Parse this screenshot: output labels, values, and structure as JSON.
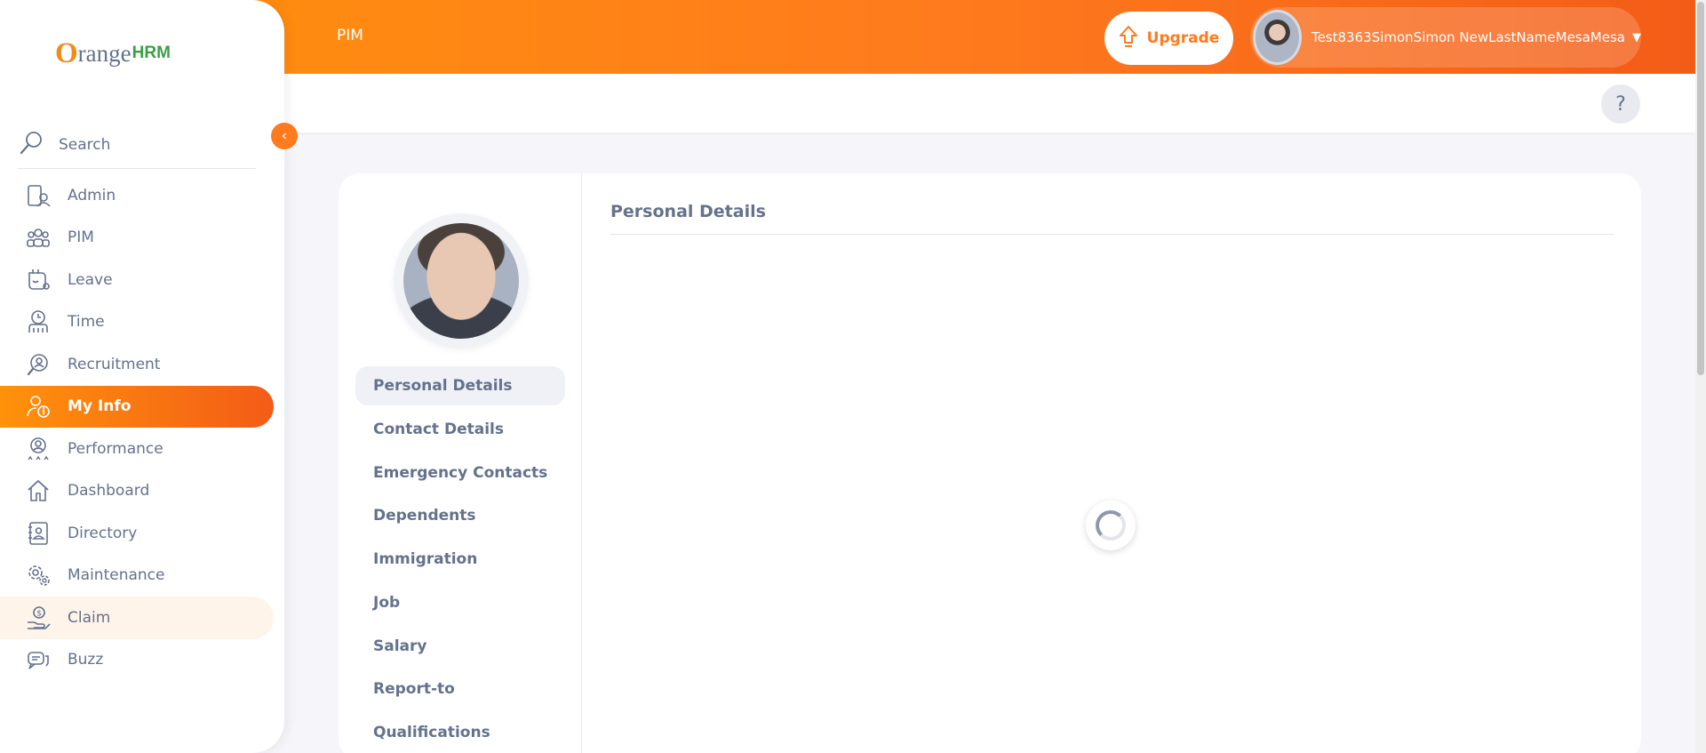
{
  "topbar": {
    "title": "PIM",
    "upgrade_label": "Upgrade",
    "user_name": "Test8363SimonSimon NewLastNameMesaMesa"
  },
  "sidebar": {
    "brand_main": "range",
    "brand_o": "O",
    "brand_suffix": "HRM",
    "search_label": "Search",
    "items": [
      {
        "label": "Admin",
        "icon": "admin-icon"
      },
      {
        "label": "PIM",
        "icon": "pim-icon"
      },
      {
        "label": "Leave",
        "icon": "leave-icon"
      },
      {
        "label": "Time",
        "icon": "time-icon"
      },
      {
        "label": "Recruitment",
        "icon": "recruitment-icon"
      },
      {
        "label": "My Info",
        "icon": "my-info-icon"
      },
      {
        "label": "Performance",
        "icon": "performance-icon"
      },
      {
        "label": "Dashboard",
        "icon": "dashboard-icon"
      },
      {
        "label": "Directory",
        "icon": "directory-icon"
      },
      {
        "label": "Maintenance",
        "icon": "maintenance-icon"
      },
      {
        "label": "Claim",
        "icon": "claim-icon"
      },
      {
        "label": "Buzz",
        "icon": "buzz-icon"
      }
    ]
  },
  "help": {
    "label": "?"
  },
  "profile": {
    "tabs": [
      {
        "label": "Personal Details"
      },
      {
        "label": "Contact Details"
      },
      {
        "label": "Emergency Contacts"
      },
      {
        "label": "Dependents"
      },
      {
        "label": "Immigration"
      },
      {
        "label": "Job"
      },
      {
        "label": "Salary"
      },
      {
        "label": "Report-to"
      },
      {
        "label": "Qualifications"
      }
    ],
    "content_title": "Personal Details"
  },
  "colors": {
    "accent": "#ff7b1d",
    "text": "#64728c"
  }
}
